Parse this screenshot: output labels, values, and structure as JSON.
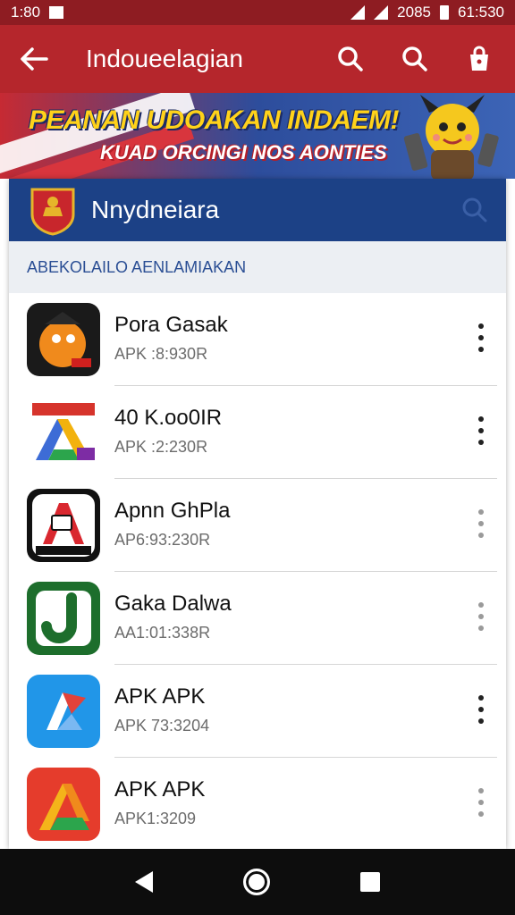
{
  "status_bar": {
    "time": "1:80",
    "right_text": "2085",
    "clock": "61:530"
  },
  "app_bar": {
    "title": "Indoueelagian"
  },
  "banner": {
    "headline": "PEANAN UDOAKAN INDAEM!",
    "subline": "KUAD ORCINGI NOS AONTIES"
  },
  "panel": {
    "title": "Nnydneiara",
    "section_header": "ABEKOLAILO AENLAMIAKAN",
    "items": [
      {
        "name": "Pora Gasak",
        "meta": "APK :8:930R",
        "icon": "pora-app-icon",
        "menu_style": "dark"
      },
      {
        "name": "40 K.oo0IR",
        "meta": "APK :2:230R",
        "icon": "drive-colored-app-icon",
        "menu_style": "dark"
      },
      {
        "name": "Apnn GhPla",
        "meta": "AP6:93:230R",
        "icon": "aspoc-app-icon",
        "menu_style": "light"
      },
      {
        "name": "Gaka Dalwa",
        "meta": "AA1:01:338R",
        "icon": "green-j-app-icon",
        "menu_style": "light"
      },
      {
        "name": "APK APK",
        "meta": "APK 73:3204",
        "icon": "blue-arrow-app-icon",
        "menu_style": "dark"
      },
      {
        "name": "APK APK",
        "meta": "APK1:3209",
        "icon": "red-triangle-app-icon",
        "menu_style": "light"
      }
    ]
  },
  "colors": {
    "appbar": "#b5262c",
    "panel_head": "#1c4186",
    "section_text": "#2a4e94"
  }
}
